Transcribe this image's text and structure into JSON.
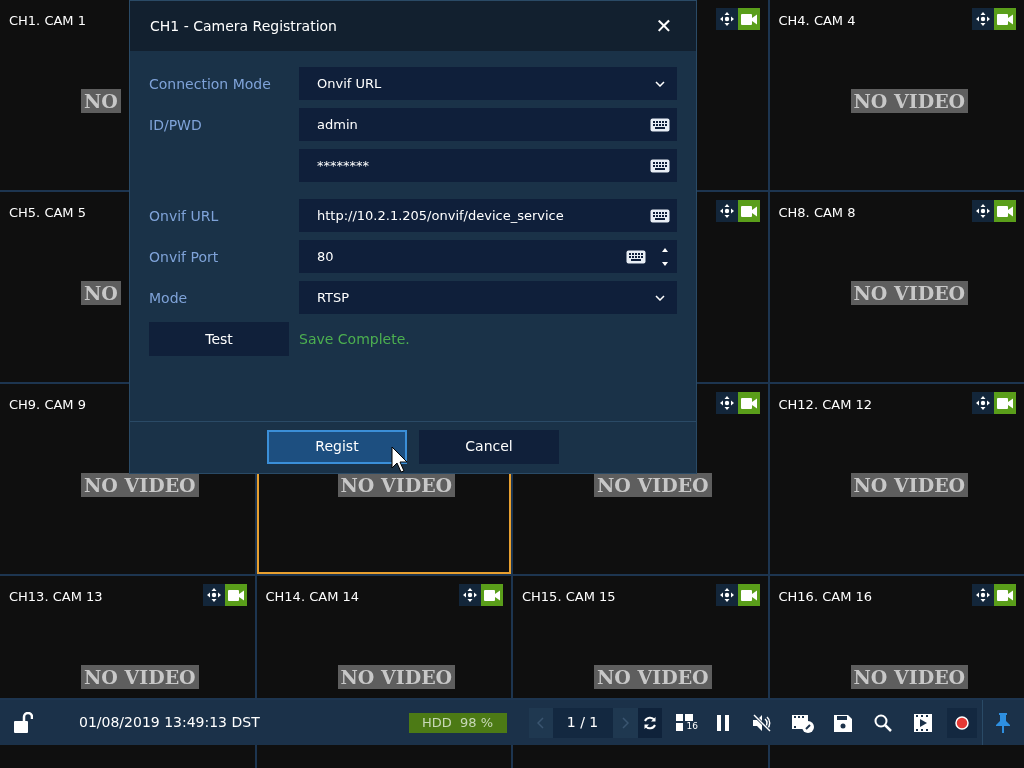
{
  "tiles": [
    {
      "label": "CH1. CAM 1",
      "no_video": "NO",
      "selected": false
    },
    {
      "selected": false
    },
    {
      "label": "CH4. CAM 4",
      "no_video": "NO VIDEO",
      "selected": false
    },
    {
      "label": "CH5. CAM 5",
      "no_video": "NO",
      "selected": false
    },
    {
      "selected": false
    },
    {
      "label": "CH8. CAM 8",
      "no_video": "NO VIDEO",
      "selected": false
    },
    {
      "label": "CH9. CAM 9",
      "no_video": "NO VIDEO",
      "selected": false
    },
    {
      "no_video": "NO VIDEO",
      "selected": true
    },
    {
      "no_video": "NO VIDEO",
      "selected": false
    },
    {
      "label": "CH12. CAM 12",
      "no_video": "NO VIDEO",
      "selected": false
    },
    {
      "label": "CH13. CAM 13",
      "no_video": "NO VIDEO",
      "selected": false
    },
    {
      "label": "CH14. CAM 14",
      "no_video": "NO VIDEO",
      "selected": false
    },
    {
      "label": "CH15. CAM 15",
      "no_video": "NO VIDEO",
      "selected": false
    },
    {
      "label": "CH16. CAM 16",
      "no_video": "NO VIDEO",
      "selected": false
    }
  ],
  "dialog": {
    "title": "CH1 - Camera Registration",
    "close": "✕",
    "fields": [
      {
        "kind": "select",
        "label": "Connection Mode",
        "value": "Onvif URL"
      },
      {
        "kind": "text",
        "label": "ID/PWD",
        "value": "admin"
      },
      {
        "kind": "text",
        "value": "********"
      },
      {
        "kind": "text",
        "label": "Onvif URL",
        "value": "http://10.2.1.205/onvif/device_service"
      },
      {
        "kind": "spin",
        "label": "Onvif Port",
        "value": "80"
      },
      {
        "kind": "select",
        "label": "Mode",
        "value": "RTSP"
      }
    ],
    "test_button": "Test",
    "message": "Save Complete.",
    "buttons": [
      {
        "label": "Regist",
        "focused": true
      },
      {
        "label": "Cancel",
        "focused": false
      }
    ]
  },
  "status_bar": {
    "datetime": "01/08/2019 13:49:13 DST",
    "hdd": "HDD  98 %",
    "page": "1 / 1",
    "layout_count": "16"
  }
}
